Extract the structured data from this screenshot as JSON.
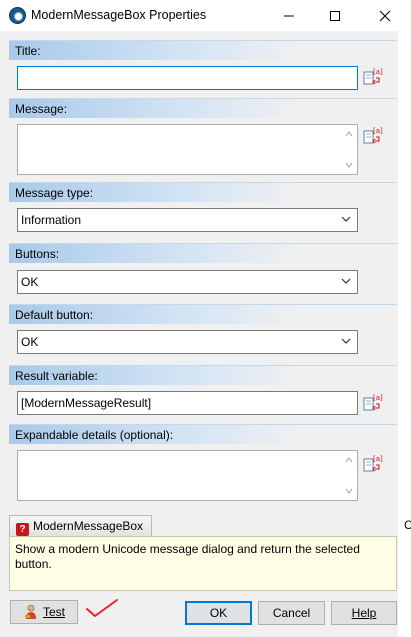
{
  "window": {
    "title": "ModernMessageBox Properties",
    "minimize_glyph": "—",
    "maximize_glyph": "☐",
    "close_glyph": "✕"
  },
  "sections": {
    "title": {
      "label": "Title:",
      "value": ""
    },
    "message": {
      "label": "Message:",
      "value": ""
    },
    "message_type": {
      "label": "Message type:",
      "value": "Information"
    },
    "buttons": {
      "label": "Buttons:",
      "value": "OK"
    },
    "default_button": {
      "label": "Default button:",
      "value": "OK"
    },
    "result_variable": {
      "label": "Result variable:",
      "value": "[ModernMessageResult]"
    },
    "expandable_details": {
      "label": "Expandable details (optional):",
      "value": ""
    }
  },
  "help": {
    "tab_label": "ModernMessageBox",
    "text": "Show a modern Unicode message dialog and return the selected button."
  },
  "footer": {
    "test_label": "Test",
    "ok_label": "OK",
    "cancel_label": "Cancel",
    "help_label": "Help"
  },
  "icons": {
    "app": "app-icon",
    "variable_insert": "variable-insert-icon",
    "help": "help-question-icon",
    "test": "test-person-icon",
    "chevron": "chevron-down-icon",
    "annotation": "red-checkmark-icon"
  },
  "background_fragment": "C",
  "colors": {
    "section_header_accent": "#a9c9e9",
    "focus_border": "#0078d7",
    "help_background": "#ffffe6",
    "annotation_red": "#e8202a"
  }
}
